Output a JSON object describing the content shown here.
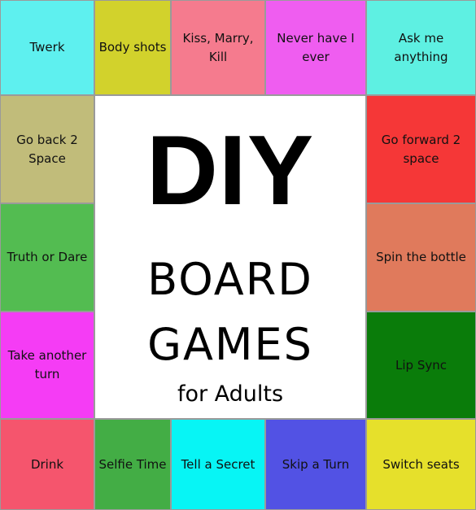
{
  "center": {
    "title": "DIY",
    "line1": "BOARD",
    "line2": "GAMES",
    "subtitle": "for Adults"
  },
  "spaces": [
    {
      "id": "twerk",
      "label": "Twerk",
      "color": "#5ef0ef"
    },
    {
      "id": "body-shots",
      "label": "Body shots",
      "color": "#d2d22c"
    },
    {
      "id": "kiss-marry-kill",
      "label": "Kiss, Marry, Kill",
      "color": "#f57b8e"
    },
    {
      "id": "never-have-i-ever",
      "label": "Never have I ever",
      "color": "#ef5df0"
    },
    {
      "id": "ask-me-anything",
      "label": "Ask me anything",
      "color": "#5ef0e2"
    },
    {
      "id": "go-back-2-space",
      "label": "Go back 2 Space",
      "color": "#c1bc7a"
    },
    {
      "id": "go-forward-2-space",
      "label": "Go forward 2 space",
      "color": "#f53737"
    },
    {
      "id": "truth-or-dare",
      "label": "Truth or Dare",
      "color": "#53bc51"
    },
    {
      "id": "spin-the-bottle",
      "label": "Spin the bottle",
      "color": "#e07a5c"
    },
    {
      "id": "take-another-turn",
      "label": "Take another turn",
      "color": "#f53cf5"
    },
    {
      "id": "lip-sync",
      "label": "Lip Sync",
      "color": "#0a7c0a"
    },
    {
      "id": "drink",
      "label": "Drink",
      "color": "#f5556d"
    },
    {
      "id": "selfie-time",
      "label": "Selfie Time",
      "color": "#43ad45"
    },
    {
      "id": "tell-a-secret",
      "label": "Tell a Secret",
      "color": "#07f5f5"
    },
    {
      "id": "skip-a-turn",
      "label": "Skip a Turn",
      "color": "#5252e4"
    },
    {
      "id": "switch-seats",
      "label": "Switch seats",
      "color": "#e6e02b"
    }
  ]
}
